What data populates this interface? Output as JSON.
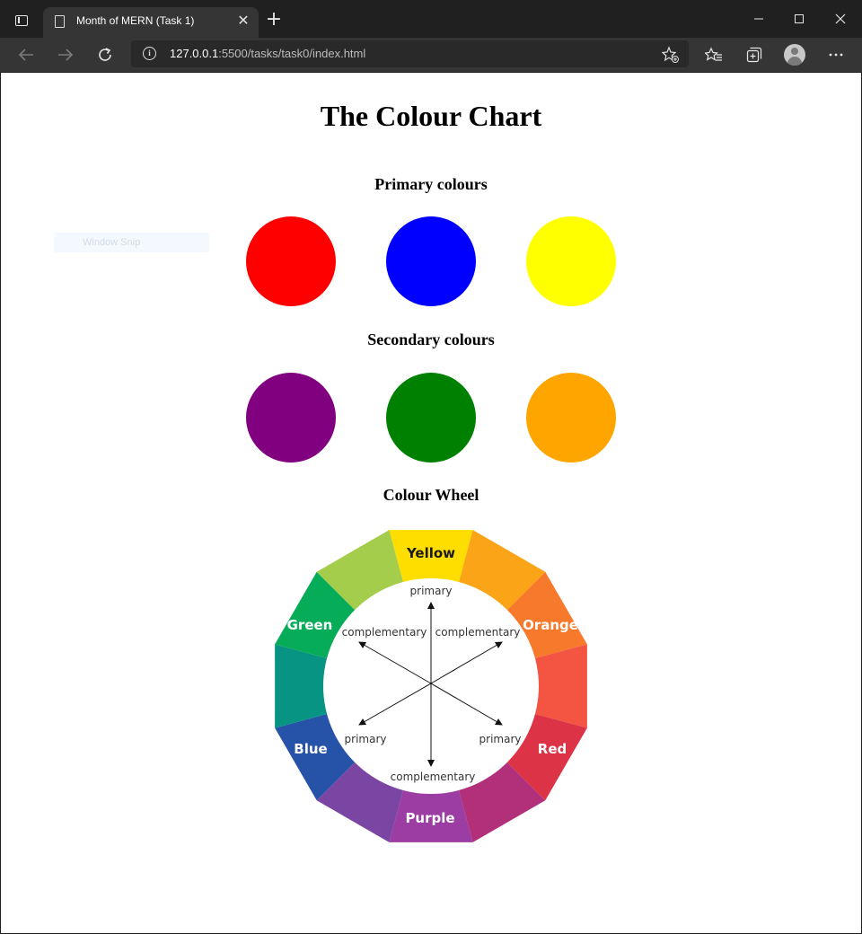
{
  "browser": {
    "tab_title": "Month of MERN (Task 1)",
    "close_tab_glyph": "✕",
    "new_tab_glyph": "+",
    "url_host": "127.0.0.1",
    "url_rest": ":5500/tasks/task0/index.html",
    "icons": [
      "window-menu-icon",
      "page-icon",
      "back-icon",
      "forward-icon",
      "refresh-icon",
      "info-icon",
      "add-favorite-icon",
      "favorites-icon",
      "collections-icon",
      "profile-icon",
      "more-icon",
      "minimize-icon",
      "maximize-icon",
      "close-icon"
    ]
  },
  "overlay": {
    "window_snip": "Window Snip"
  },
  "page": {
    "title": "The Colour Chart",
    "primary_heading": "Primary colours",
    "secondary_heading": "Secondary colours",
    "wheel_heading": "Colour Wheel",
    "primary_colours": [
      "#ff0000",
      "#0000ff",
      "#ffff00"
    ],
    "secondary_colours": [
      "#800080",
      "#008000",
      "#ffa500"
    ]
  },
  "wheel": {
    "labels": {
      "yellow": "Yellow",
      "orange": "Orange",
      "red": "Red",
      "purple": "Purple",
      "blue": "Blue",
      "green": "Green"
    },
    "inner": {
      "top": "primary",
      "bottom_left": "primary",
      "bottom_right": "primary",
      "upper_left": "complementary",
      "upper_right": "complementary",
      "bottom": "complementary"
    },
    "segment_colors": [
      "#fedd00",
      "#fba418",
      "#f7792b",
      "#f45442",
      "#dc3446",
      "#b2307a",
      "#9b3da3",
      "#7b46a3",
      "#2653a7",
      "#079483",
      "#06ac58",
      "#a3cd4a"
    ]
  }
}
